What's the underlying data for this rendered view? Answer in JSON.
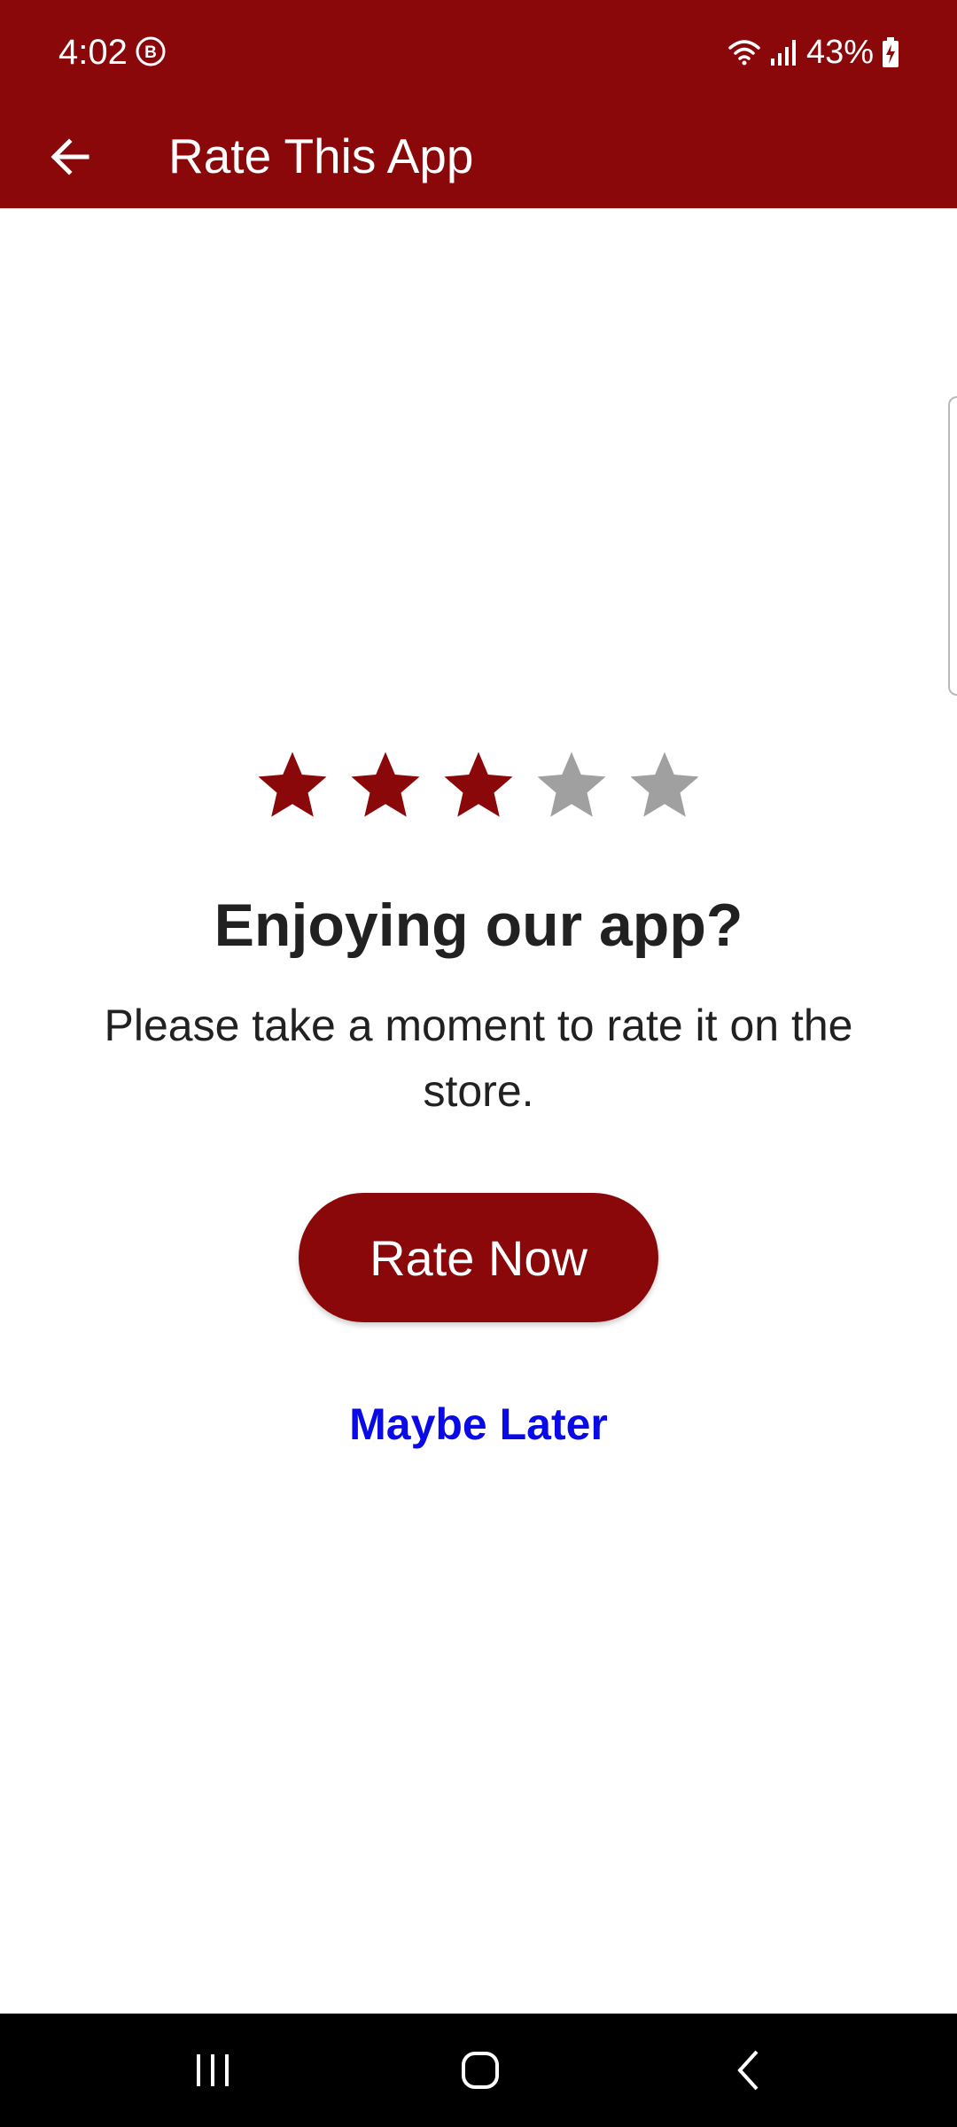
{
  "status_bar": {
    "time": "4:02",
    "battery_percent": "43%",
    "icons": [
      "b-badge-icon",
      "wifi-icon",
      "signal-icon",
      "battery-charging-icon"
    ]
  },
  "app_bar": {
    "title": "Rate This App",
    "back_icon": "arrow-left-icon",
    "background_color": "#8b080a"
  },
  "rating": {
    "value": 3,
    "max": 5,
    "filled_color": "#8b080a",
    "empty_color": "#a0a0a0",
    "icon": "star-icon"
  },
  "content": {
    "headline": "Enjoying our app?",
    "message": "Please take a moment to rate it on the store.",
    "primary_button": "Rate Now",
    "secondary_link": "Maybe Later",
    "link_color": "#0a0ae6"
  },
  "nav_bar": {
    "icons": [
      "recents-icon",
      "home-icon",
      "back-icon"
    ]
  }
}
